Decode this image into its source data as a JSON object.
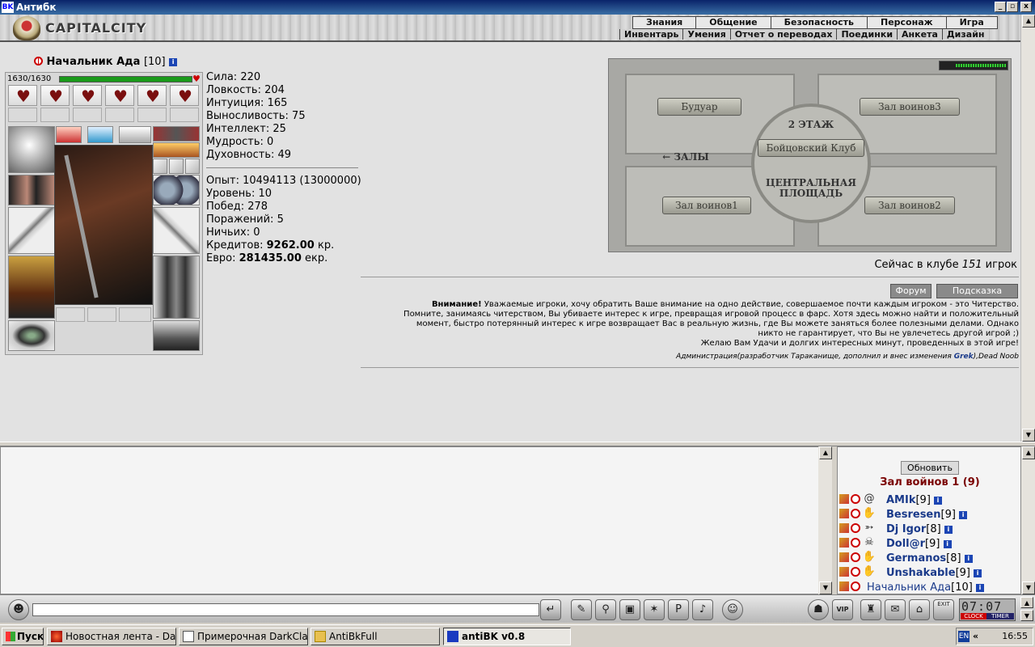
{
  "window": {
    "icon_text": "BK",
    "title": "Антибк",
    "btn_min": "_",
    "btn_max": "▫",
    "btn_close": "x"
  },
  "header": {
    "logo": "CAPITALCITY",
    "menu_top": [
      "Знания",
      "Общение",
      "Безопасность",
      "Персонаж",
      "Игра"
    ],
    "menu_sub": [
      "Инвентарь",
      "Умения",
      "Отчет о переводах",
      "Поединки",
      "Анкета",
      "Дизайн"
    ]
  },
  "character": {
    "name": "Начальник Ада",
    "level": "[10]",
    "hp": "1630/1630",
    "hp_fraction": 1.0
  },
  "stats": {
    "sila": "Сила: 220",
    "lovk": "Ловкость: 204",
    "intuit": "Интуиция: 165",
    "vyn": "Выносливость: 75",
    "intel": "Интеллект: 25",
    "mudr": "Мудрость: 0",
    "duh": "Духовность: 49",
    "opyt": "Опыт: 10494113 (13000000)",
    "uroven": "Уровень: 10",
    "pobed": "Побед: 278",
    "porazh": "Поражений: 5",
    "nich": "Ничьих: 0",
    "kred_label": "Кредитов: ",
    "kred_value": "9262.00",
    "kred_unit": " кр.",
    "evro_label": "Евро: ",
    "evro_value": "281435.00",
    "evro_unit": " екр."
  },
  "map": {
    "floor": "2 ЭТАЖ",
    "boudoir": "Будуар",
    "hall3": "Зал воинов3",
    "club": "Бойцовский Клуб",
    "halls": "← ЗАЛЫ",
    "central": "ЦЕНТРАЛЬНАЯ ПЛОЩАДЬ",
    "hall1": "Зал воинов1",
    "hall2": "Зал воинов2"
  },
  "online": {
    "prefix": "Сейчас в клубе ",
    "count": "151",
    "suffix": " игрок"
  },
  "buttons": {
    "forum": "Форум",
    "hint": "Подсказка",
    "refresh": "Обновить"
  },
  "notice": {
    "title": "Внимание!",
    "line1": " Уважаемые игроки, хочу обратить Ваше внимание на одно действие, совершаемое почти каждым игроком - это Читерство.",
    "line2": "Помните, занимаясь читерством, Вы убиваете интерес к игре, превращая игровой процесс в фарс. Хотя здесь можно найти и положительный",
    "line3": "момент, быстро потерянный интерес к игре возвращает Вас в реальную жизнь, где Вы можете заняться более полезными делами. Однако",
    "line4": "никто не гарантирует, что Вы не увлечетесь другой игрой ;)",
    "line5": "Желаю Вам Удачи и долгих интересных минут, проведенных в этой игре!",
    "sig_a": "Администрация(разработчик Тараканище, дополнил и внес изменения ",
    "sig_grek": "Grek",
    "sig_b": "),Dead Noob"
  },
  "room": {
    "title": "Зал войнов 1 (9)"
  },
  "users": [
    {
      "name": "AMIk",
      "level": "[9]",
      "sign": "@"
    },
    {
      "name": "Besresen",
      "level": "[9]",
      "sign": "✋"
    },
    {
      "name": "Dj Igor",
      "level": "[8]",
      "sign": "➳"
    },
    {
      "name": "Doll@r",
      "level": "[9]",
      "sign": "☠"
    },
    {
      "name": "Germanos",
      "level": "[8]",
      "sign": "✋"
    },
    {
      "name": "Unshakable",
      "level": "[9]",
      "sign": "✋"
    },
    {
      "name": "Начальник Ада",
      "level": "[10]",
      "sign": ""
    }
  ],
  "toolbar": {
    "clock": "07:07",
    "clock_label": "CLOCK",
    "timer_label": "TIMER",
    "exit": "EXIT",
    "vip": "VIP"
  },
  "taskbar": {
    "start": "Пуск",
    "tasks": [
      "Новостная лента - Dark...",
      "Примерочная DarkClan ...",
      "AntiBkFull",
      "antiBK v0.8"
    ],
    "lang": "EN",
    "chevron": "«",
    "time": "16:55"
  }
}
